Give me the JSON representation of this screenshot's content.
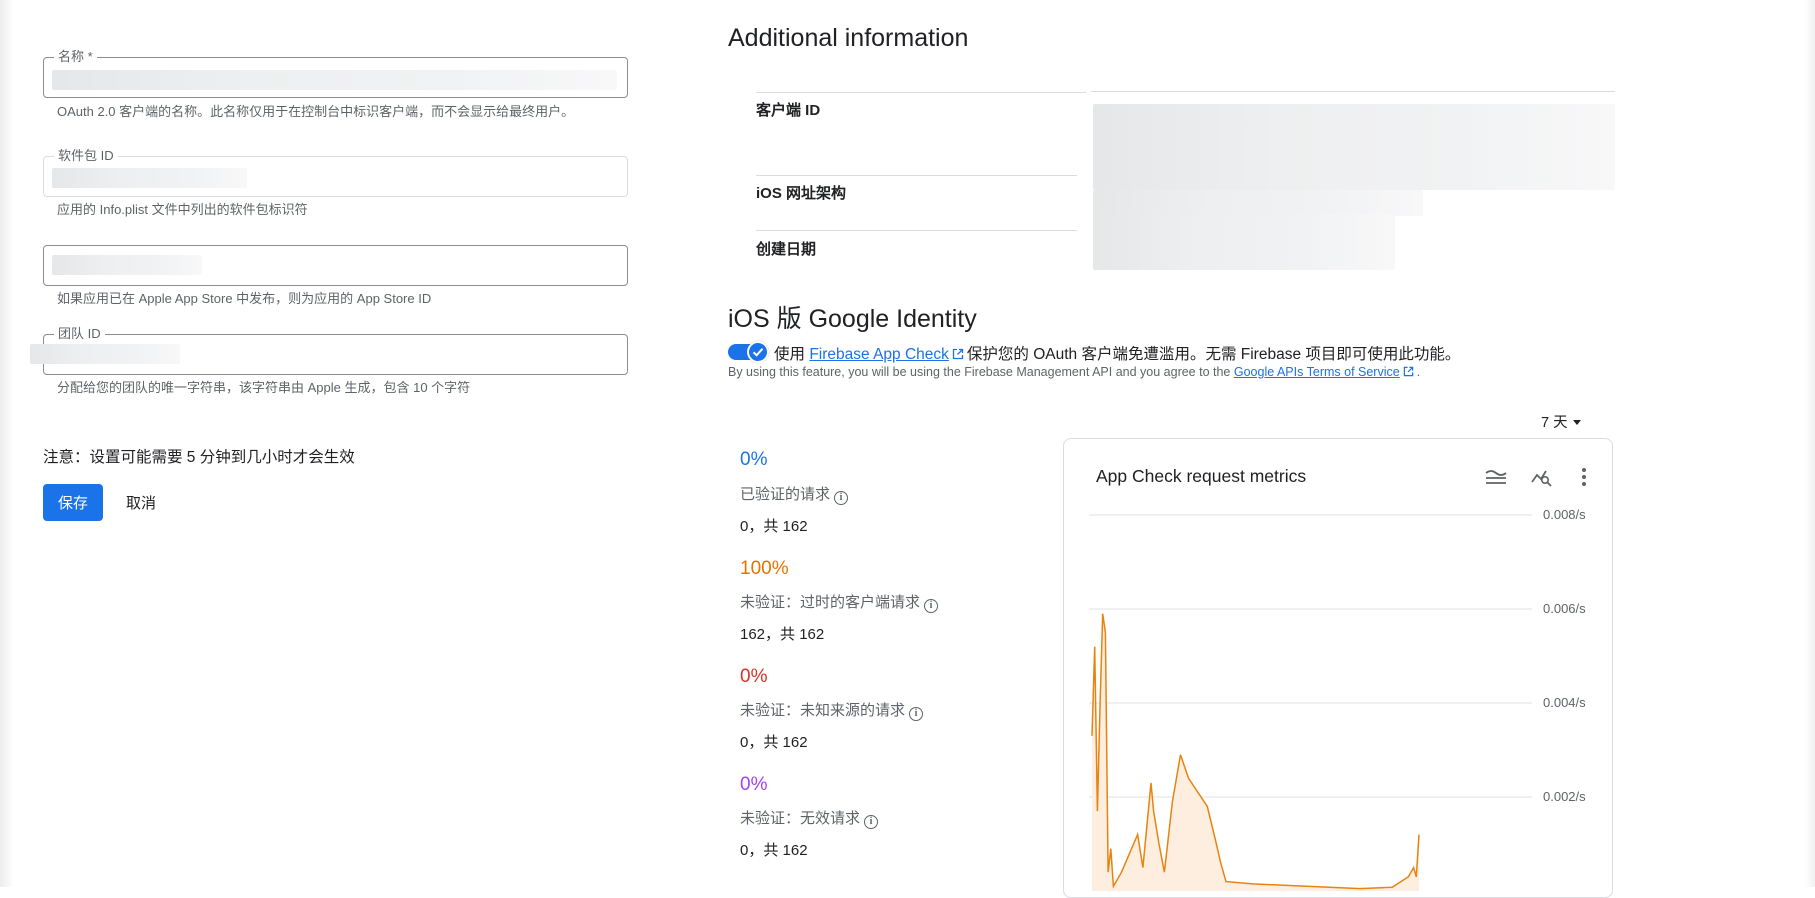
{
  "form": {
    "name_field": {
      "label": "名称 *",
      "hint": "OAuth 2.0 客户端的名称。此名称仅用于在控制台中标识客户端，而不会显示给最终用户。"
    },
    "bundle_field": {
      "label": "软件包 ID",
      "hint": "应用的 Info.plist 文件中列出的软件包标识符"
    },
    "appstore_field": {
      "hint": "如果应用已在 Apple App Store 中发布，则为应用的 App Store ID"
    },
    "team_field": {
      "label": "团队 ID",
      "hint": "分配给您的团队的唯一字符串，该字符串由 Apple 生成，包含 10 个字符"
    },
    "note": "注意：设置可能需要 5 分钟到几小时才会生效",
    "save_label": "保存",
    "cancel_label": "取消"
  },
  "additional_info": {
    "title": "Additional information",
    "rows": [
      {
        "label": "客户端 ID"
      },
      {
        "label": "iOS 网址架构"
      },
      {
        "label": "创建日期"
      }
    ]
  },
  "google_identity": {
    "title": "iOS 版 Google Identity",
    "toggle_on": true,
    "line_prefix": "使用",
    "link_text": "Firebase App Check",
    "line_suffix": "保护您的 OAuth 客户端免遭滥用。无需 Firebase 项目即可使用此功能。",
    "terms_prefix": "By using this feature, you will be using the Firebase Management API and you agree to the",
    "terms_link": "Google APIs Terms of Service",
    "terms_suffix": ".",
    "range_label": "7 天"
  },
  "stats": [
    {
      "pct": "0%",
      "color": "#1a73e8",
      "label": "已验证的请求",
      "count": "0，共 162"
    },
    {
      "pct": "100%",
      "color": "#e37400",
      "label": "未验证：过时的客户端请求",
      "count": "162，共 162"
    },
    {
      "pct": "0%",
      "color": "#d93025",
      "label": "未验证：未知来源的请求",
      "count": "0，共 162"
    },
    {
      "pct": "0%",
      "color": "#a142f4",
      "label": "未验证：无效请求",
      "count": "0，共 162"
    }
  ],
  "metrics_card": {
    "title": "App Check request metrics",
    "icons": [
      "legend-toggle-icon",
      "query-stats-icon",
      "more-vert-icon"
    ]
  },
  "chart_data": {
    "type": "area",
    "title": "App Check request metrics",
    "xlabel": "",
    "ylabel": "",
    "y_ticks": [
      "0.008/s",
      "0.006/s",
      "0.004/s",
      "0.002/s"
    ],
    "ylim": [
      0,
      0.008
    ],
    "grid": true,
    "series": [
      {
        "color": "#e8830f",
        "fill": "#fdeee0",
        "points": [
          [
            0,
            0.0033
          ],
          [
            1,
            0.0052
          ],
          [
            2,
            0.0017
          ],
          [
            3,
            0.0039
          ],
          [
            4,
            0.0059
          ],
          [
            5,
            0.0055
          ],
          [
            6,
            0.0004
          ],
          [
            7,
            0.0009
          ],
          [
            8,
            0.0001
          ],
          [
            9,
            0.0002
          ],
          [
            11,
            0.0004
          ],
          [
            17,
            0.0012
          ],
          [
            19,
            0.0005
          ],
          [
            22,
            0.0023
          ],
          [
            23,
            0.0017
          ],
          [
            25,
            0.001
          ],
          [
            27,
            0.0004
          ],
          [
            30,
            0.0019
          ],
          [
            33,
            0.0029
          ],
          [
            36,
            0.0024
          ],
          [
            43,
            0.0018
          ],
          [
            46,
            0.0011
          ],
          [
            48,
            0.0006
          ],
          [
            50,
            0.0002
          ],
          [
            60,
            0.00015
          ],
          [
            80,
            0.0001
          ],
          [
            100,
            5e-05
          ],
          [
            112,
            8e-05
          ],
          [
            118,
            0.0003
          ],
          [
            120,
            0.0005
          ],
          [
            121,
            0.0003
          ],
          [
            122,
            0.0012
          ]
        ]
      }
    ]
  }
}
